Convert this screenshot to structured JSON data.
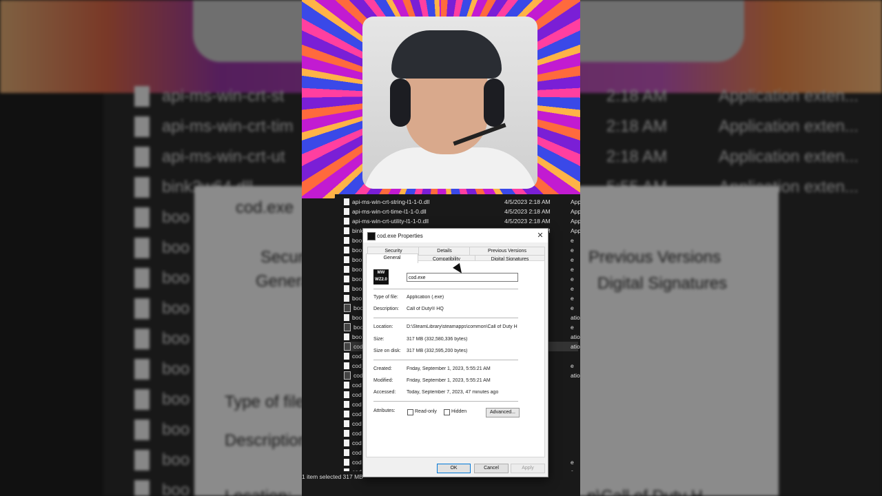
{
  "background": {
    "dialog_title": "cod.exe",
    "tabs": [
      "Secur",
      "Previous Versions",
      "Genera",
      "Digital Signatures"
    ],
    "labels": [
      "Type of file:",
      "Description",
      "Location:"
    ],
    "location_tail": "n\\Call of Duty H",
    "rows": [
      {
        "name": "api-ms-win-crt-st",
        "time": "2:18 AM",
        "type": "Application exten..."
      },
      {
        "name": "api-ms-win-crt-tim",
        "time": "2:18 AM",
        "type": "Application exten..."
      },
      {
        "name": "api-ms-win-crt-ut",
        "time": "2:18 AM",
        "type": "Application exten..."
      },
      {
        "name": "bink2w64.dll",
        "time": "5:55 AM",
        "type": "Application exten..."
      },
      {
        "name": "boo",
        "time": "",
        "type": "e"
      },
      {
        "name": "boo",
        "time": "",
        "type": "e"
      },
      {
        "name": "boo",
        "time": "",
        "type": "e"
      },
      {
        "name": "boo",
        "time": "",
        "type": "e"
      },
      {
        "name": "boo",
        "time": "",
        "type": "e"
      },
      {
        "name": "boo",
        "time": "",
        "type": "e"
      },
      {
        "name": "boo",
        "time": "",
        "type": "e"
      },
      {
        "name": "boo",
        "time": "",
        "type": "e"
      },
      {
        "name": "boo",
        "time": "",
        "type": "e"
      },
      {
        "name": "boo",
        "time": "",
        "type": "e"
      }
    ]
  },
  "file_list": {
    "rows": [
      {
        "name": "api-ms-win-crt-string-l1-1-0.dll",
        "time": "4/5/2023 2:18 AM",
        "type": "Application exten..."
      },
      {
        "name": "api-ms-win-crt-time-l1-1-0.dll",
        "time": "4/5/2023 2:18 AM",
        "type": "Application exten..."
      },
      {
        "name": "api-ms-win-crt-utility-l1-1-0.dll",
        "time": "4/5/2023 2:18 AM",
        "type": "Application exten..."
      },
      {
        "name": "bink2w64.dll",
        "time": "9/1/2023 5:55 AM",
        "type": "Application exten..."
      },
      {
        "name": "boo",
        "time": "",
        "type": "e"
      },
      {
        "name": "boo",
        "time": "",
        "type": "e"
      },
      {
        "name": "boo",
        "time": "",
        "type": "e"
      },
      {
        "name": "boo",
        "time": "",
        "type": "e"
      },
      {
        "name": "boo",
        "time": "",
        "type": "e"
      },
      {
        "name": "boo",
        "time": "",
        "type": "e"
      },
      {
        "name": "boo",
        "time": "",
        "type": "e"
      },
      {
        "name": "boo",
        "time": "",
        "type": "e"
      },
      {
        "name": "boo",
        "time": "",
        "type": "ation"
      },
      {
        "name": "boo",
        "time": "",
        "type": "e"
      },
      {
        "name": "boo",
        "time": "",
        "type": "ation"
      },
      {
        "name": "cod",
        "time": "",
        "type": "ation"
      },
      {
        "name": "cod_",
        "time": "",
        "type": ""
      },
      {
        "name": "cod_",
        "time": "",
        "type": "e"
      },
      {
        "name": "cod_",
        "time": "",
        "type": "ation"
      },
      {
        "name": "cod",
        "time": "",
        "type": ""
      },
      {
        "name": "cod",
        "time": "",
        "type": ""
      },
      {
        "name": "cod",
        "time": "",
        "type": ""
      },
      {
        "name": "cod",
        "time": "",
        "type": ""
      },
      {
        "name": "cod",
        "time": "",
        "type": ""
      },
      {
        "name": "cod",
        "time": "",
        "type": ""
      },
      {
        "name": "cod",
        "time": "",
        "type": ""
      },
      {
        "name": "cod",
        "time": "",
        "type": ""
      },
      {
        "name": "cod",
        "time": "",
        "type": "e"
      },
      {
        "name": "cod",
        "time": "",
        "type": "e"
      }
    ],
    "status": "1 item selected  317 MB"
  },
  "dialog": {
    "title": "cod.exe Properties",
    "close": "✕",
    "icon_top": "MW",
    "icon_bottom": "WZ2.0",
    "tabs_top": [
      "Security",
      "Details",
      "Previous Versions"
    ],
    "tabs_bottom": [
      "General",
      "Compatibility",
      "Digital Signatures"
    ],
    "file_name": "cod.exe",
    "type_label": "Type of file:",
    "type_value": "Application (.exe)",
    "desc_label": "Description:",
    "desc_value": "Call of Duty® HQ",
    "location_label": "Location:",
    "location_value": "D:\\SteamLibrary\\steamapps\\common\\Call of Duty H",
    "size_label": "Size:",
    "size_value": "317 MB (332,580,336 bytes)",
    "size_disk_label": "Size on disk:",
    "size_disk_value": "317 MB (332,595,200 bytes)",
    "created_label": "Created:",
    "created_value": "Friday, September 1, 2023, 5:55:21 AM",
    "modified_label": "Modified:",
    "modified_value": "Friday, September 1, 2023, 5:55:21 AM",
    "accessed_label": "Accessed:",
    "accessed_value": "Today, September 7, 2023, 47 minutes ago",
    "attributes_label": "Attributes:",
    "readonly_label": "Read-only",
    "hidden_label": "Hidden",
    "advanced_label": "Advanced...",
    "ok_label": "OK",
    "cancel_label": "Cancel",
    "apply_label": "Apply"
  }
}
